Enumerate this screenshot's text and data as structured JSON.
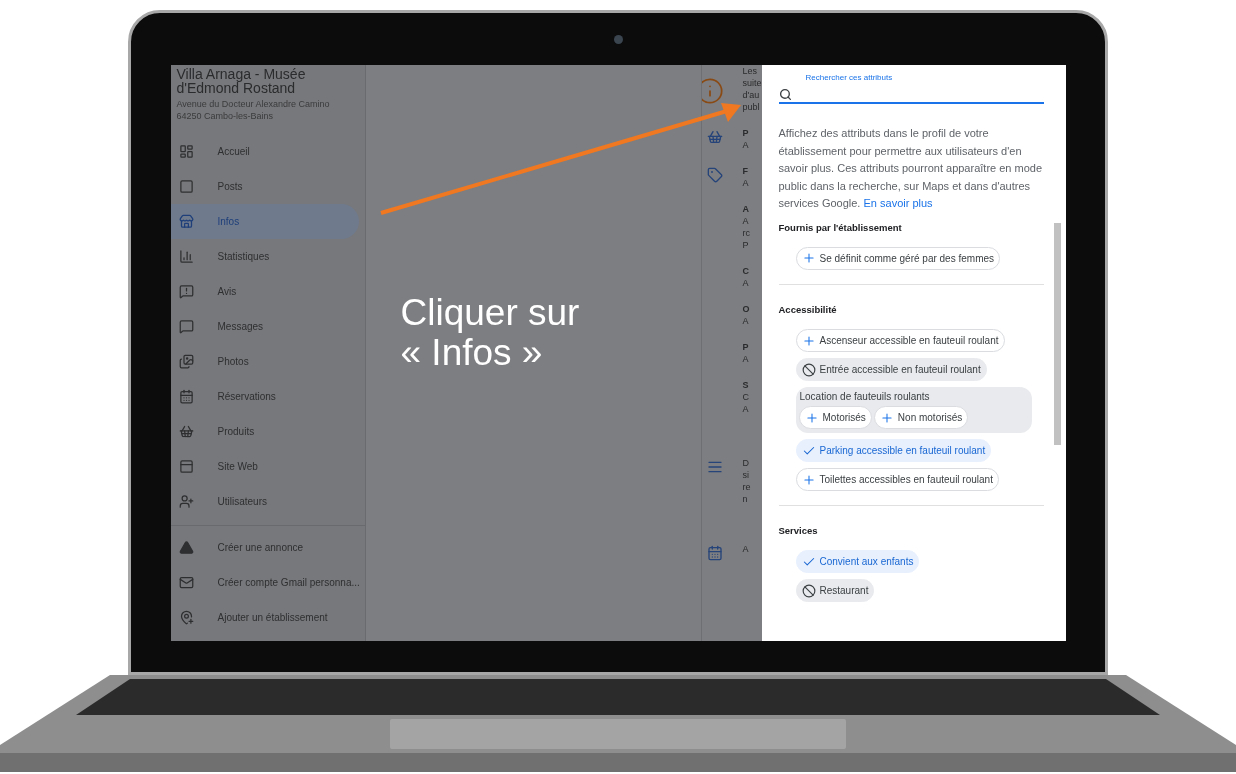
{
  "business": {
    "name": "Villa Arnaga - Musée d'Edmond Rostand",
    "address": "Avenue du Docteur Alexandre Camino",
    "city": "64250 Cambo-les-Bains"
  },
  "sidebar": {
    "items": [
      {
        "label": "Accueil",
        "selected": false
      },
      {
        "label": "Posts",
        "selected": false
      },
      {
        "label": "Infos",
        "selected": true
      },
      {
        "label": "Statistiques",
        "selected": false
      },
      {
        "label": "Avis",
        "selected": false
      },
      {
        "label": "Messages",
        "selected": false
      },
      {
        "label": "Photos",
        "selected": false
      },
      {
        "label": "Réservations",
        "selected": false
      },
      {
        "label": "Produits",
        "selected": false
      },
      {
        "label": "Site Web",
        "selected": false
      },
      {
        "label": "Utilisateurs",
        "selected": false
      }
    ],
    "extra_items": [
      "Créer une annonce",
      "Créer compte Gmail personna...",
      "Ajouter un établissement"
    ]
  },
  "info_column": {
    "intro": [
      "Les",
      "suite",
      "d'au",
      "publ"
    ],
    "rows": [
      {
        "lines": [
          "P",
          "A"
        ]
      },
      {
        "lines": [
          "F",
          "A"
        ]
      },
      {
        "lines": [
          "A",
          "A",
          "rc",
          "P"
        ]
      },
      {
        "lines": [
          "C",
          "A"
        ]
      },
      {
        "lines": [
          "O",
          "A"
        ]
      },
      {
        "lines": [
          "P",
          "A"
        ]
      },
      {
        "lines": [
          "S",
          "C",
          "A"
        ]
      },
      {
        "lines": [
          "D",
          "si",
          "re",
          "n"
        ]
      },
      {
        "lines": [
          "A"
        ]
      }
    ]
  },
  "annotation": {
    "text": "Cliquer sur « Infos »"
  },
  "attributes_panel": {
    "search_label": "Rechercher ces attributs",
    "description": "Affichez des attributs dans le profil de votre établissement pour permettre aux utilisateurs d'en savoir plus. Ces attributs pourront apparaître en mode public dans la recherche, sur Maps et dans d'autres services Google.",
    "learn_more": "En savoir plus",
    "sections": [
      {
        "title": "Fournis par l'établissement",
        "chips": [
          {
            "kind": "add",
            "label": "Se définit comme géré par des femmes"
          }
        ]
      },
      {
        "title": "Accessibilité",
        "chips": [
          {
            "kind": "add",
            "label": "Ascenseur accessible en fauteuil roulant"
          },
          {
            "kind": "no",
            "label": "Entrée accessible en fauteuil roulant"
          },
          {
            "kind": "group",
            "label": "Location de fauteuils roulants",
            "options": [
              {
                "kind": "add",
                "label": "Motorisés"
              },
              {
                "kind": "add",
                "label": "Non motorisés"
              }
            ]
          },
          {
            "kind": "yes",
            "label": "Parking accessible en fauteuil roulant"
          },
          {
            "kind": "add",
            "label": "Toilettes accessibles en fauteuil roulant"
          }
        ]
      },
      {
        "title": "Services",
        "chips": [
          {
            "kind": "yes",
            "label": "Convient aux enfants"
          },
          {
            "kind": "no",
            "label": "Restaurant"
          }
        ]
      }
    ]
  }
}
